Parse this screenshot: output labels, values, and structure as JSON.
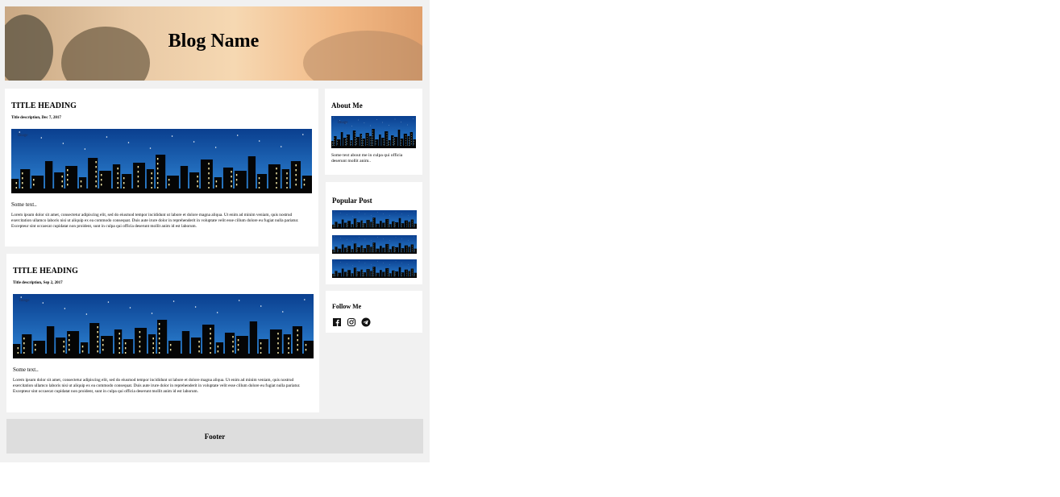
{
  "header": {
    "blog_name": "Blog Name"
  },
  "posts": [
    {
      "title": "TITLE HEADING",
      "date": "Title description, Dec 7, 2017",
      "image_label": "Image",
      "some_text": "Some text..",
      "body": "Lorem ipsum dolor sit amet, consectetur adipiscing elit, sed do eiusmod tempor incididunt ut labore et dolore magna aliqua. Ut enim ad minim veniam, quis nostrud exercitation ullamco laboris nisi ut aliquip ex ea commodo consequat. Duis aute irure dolor in reprehenderit in voluptate velit esse cillum dolore eu fugiat nulla pariatur. Excepteur sint occaecat cupidatat non proident, sunt in culpa qui officia deserunt mollit anim id est laborum."
    },
    {
      "title": "TITLE HEADING",
      "date": "Title description, Sep 2, 2017",
      "image_label": "Image",
      "some_text": "Some text..",
      "body": "Lorem ipsum dolor sit amet, consectetur adipiscing elit, sed do eiusmod tempor incididunt ut labore et dolore magna aliqua. Ut enim ad minim veniam, quis nostrud exercitation ullamco laboris nisi ut aliquip ex ea commodo consequat. Duis aute irure dolor in reprehenderit in voluptate velit esse cillum dolore eu fugiat nulla pariatur. Excepteur sint occaecat cupidatat non proident, sunt in culpa qui officia deserunt mollit anim id est laborum."
    }
  ],
  "sidebar": {
    "about": {
      "title": "About Me",
      "image_label": "Image",
      "text": "Some text about me in culpa qui officia deserunt mollit anim.."
    },
    "popular": {
      "title": "Popular Post"
    },
    "follow": {
      "title": "Follow Me",
      "icons": [
        "facebook-icon",
        "instagram-icon",
        "telegram-icon"
      ]
    }
  },
  "footer": {
    "label": "Footer"
  },
  "colors": {
    "page_bg": "#f1f1f1",
    "card_bg": "#ffffff",
    "footer_bg": "#dddddd",
    "sky_top": "#0a3f8f",
    "sky_bottom": "#2f86d6"
  }
}
